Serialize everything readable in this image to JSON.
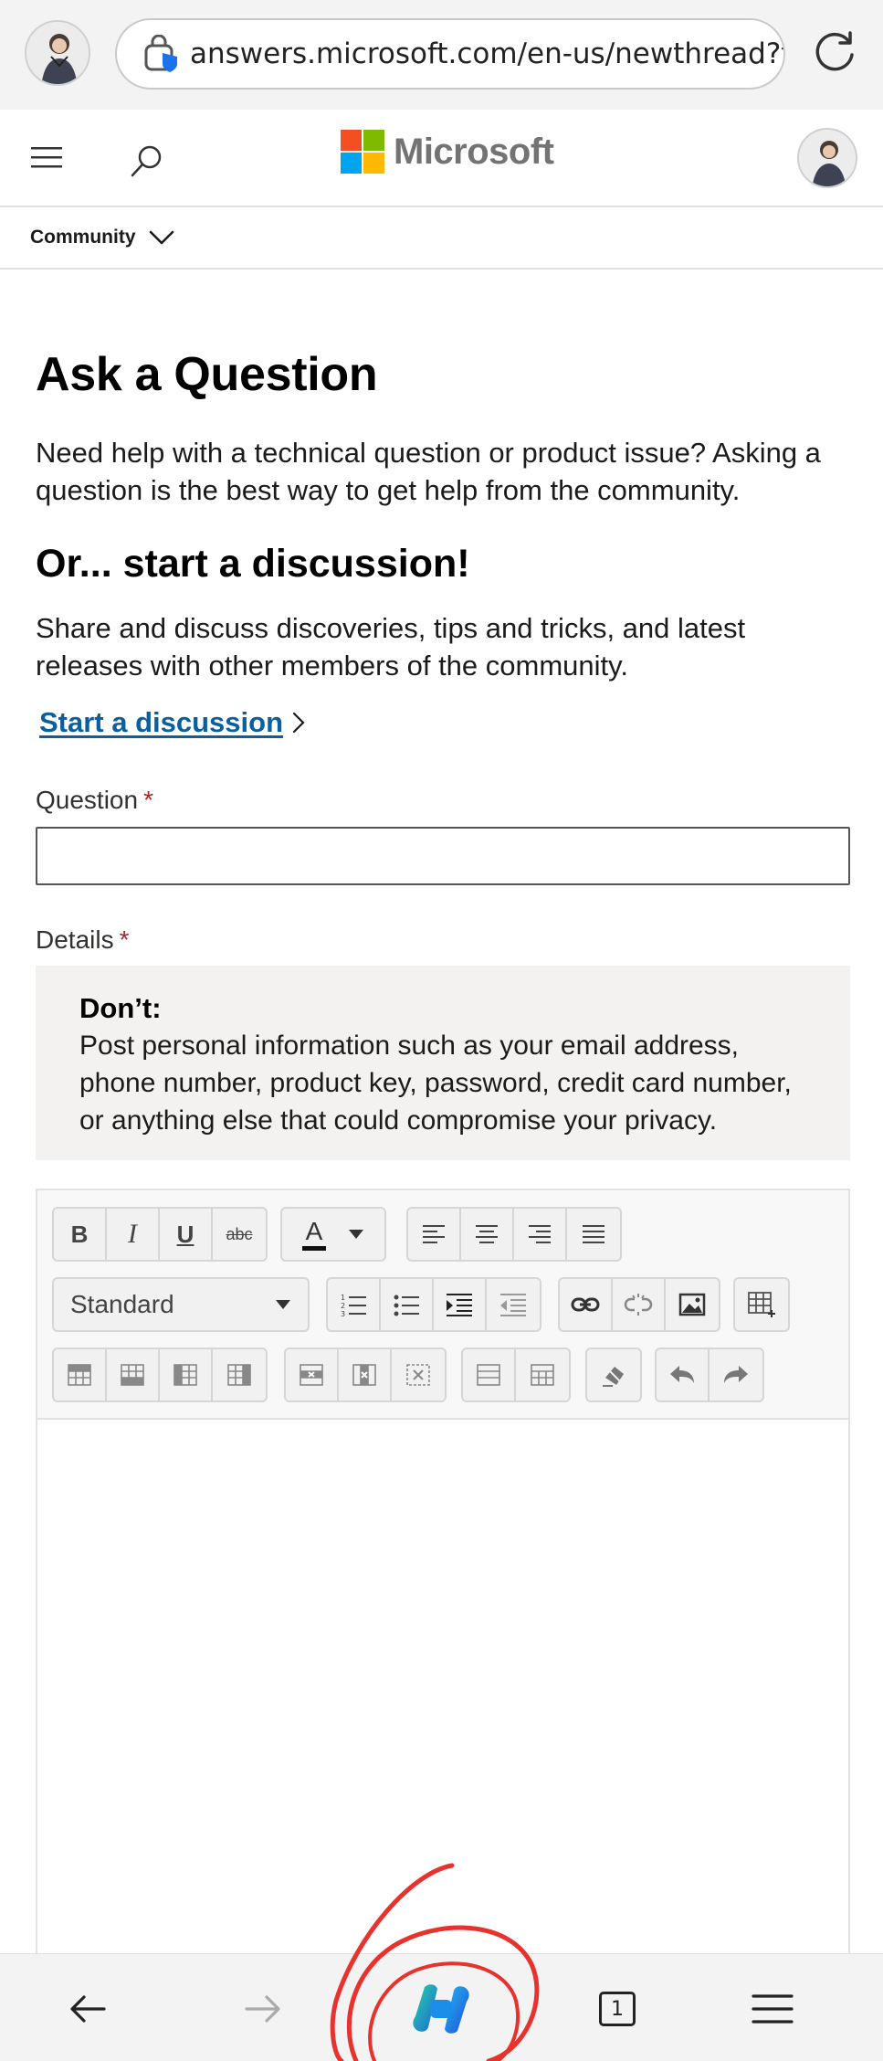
{
  "browser": {
    "url": "answers.microsoft.com/en-us/newthread?threadtype=questions",
    "tab_count": "1"
  },
  "header": {
    "logo_text": "Microsoft",
    "logo_colors": [
      "#f25022",
      "#7fba00",
      "#00a4ef",
      "#ffb900"
    ]
  },
  "nav": {
    "community_label": "Community"
  },
  "page": {
    "title": "Ask a Question",
    "intro": "Need help with a technical question or product issue? Asking a question is the best way to get help from the community.",
    "discussion_title": "Or... start a discussion!",
    "discussion_text": "Share and discuss discoveries, tips and tricks, and latest releases with other members of the community.",
    "discussion_link": "Start a discussion"
  },
  "form": {
    "question_label": "Question",
    "details_label": "Details",
    "required_mark": "*",
    "question_value": ""
  },
  "warning": {
    "title": "Don’t:",
    "text": "Post personal information such as your email address, phone number, product key, password, credit card number, or anything else that could compromise your privacy."
  },
  "toolbar": {
    "bold": "B",
    "italic": "I",
    "underline": "U",
    "strike": "abc",
    "font_color_letter": "A",
    "style_selected": "Standard"
  },
  "colors": {
    "link": "#0a5fa1",
    "required": "#a4262c",
    "annotation": "#e8322d"
  }
}
